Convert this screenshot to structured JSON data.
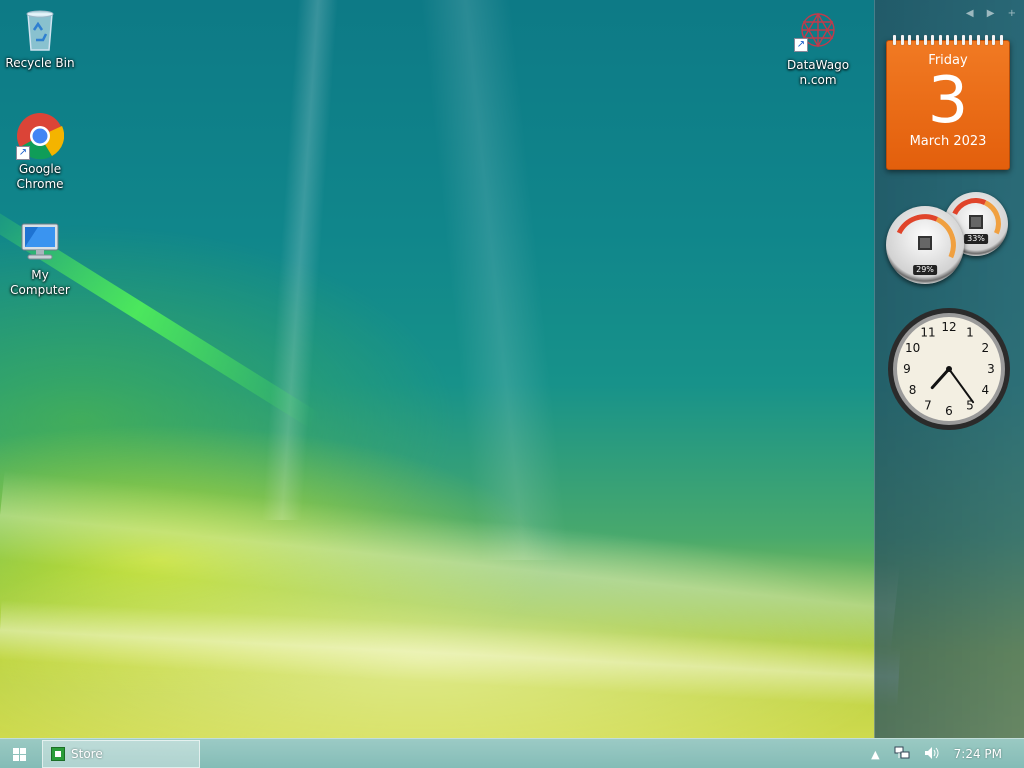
{
  "desktop": {
    "icons": [
      {
        "label": "Recycle Bin",
        "icon": "recycle-bin-icon"
      },
      {
        "label": "Google Chrome",
        "icon": "chrome-icon"
      },
      {
        "label": "My Computer",
        "icon": "computer-icon"
      },
      {
        "label": "DataWagon.com",
        "icon": "datawagon-icon"
      }
    ]
  },
  "sidebar": {
    "controls": [
      "previous-icon",
      "next-icon",
      "add-icon"
    ],
    "calendar": {
      "weekday": "Friday",
      "day": "3",
      "month_year": "March 2023"
    },
    "cpu_meter": {
      "cpu_percent": "29%",
      "memory_percent": "33%"
    },
    "clock": {
      "numerals": [
        "12",
        "1",
        "2",
        "3",
        "4",
        "5",
        "6",
        "7",
        "8",
        "9",
        "10",
        "11"
      ],
      "hour": 7,
      "minute": 24
    }
  },
  "taskbar": {
    "start_icon": "windows-logo-icon",
    "tasks": [
      {
        "label": "Store",
        "icon": "store-icon"
      }
    ],
    "tray": {
      "icons": [
        "show-hidden-icons-chevron",
        "network-icon",
        "volume-icon"
      ],
      "time": "7:24 PM"
    }
  },
  "colors": {
    "calendar_orange": "#e8661a",
    "gauge_red": "#e0442a",
    "taskbar": "#8cc3c8"
  }
}
